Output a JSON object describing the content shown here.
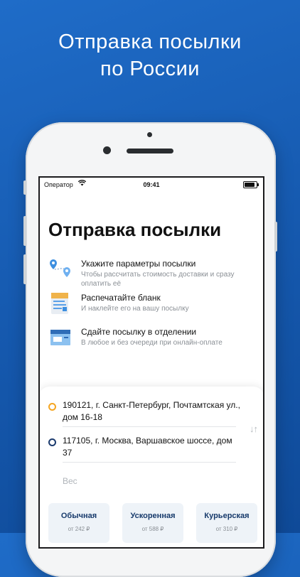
{
  "headline": {
    "line1": "Отправка посылки",
    "line2": "по России"
  },
  "status_bar": {
    "operator": "Оператор",
    "time": "09:41"
  },
  "screen": {
    "title": "Отправка посылки",
    "steps": [
      {
        "icon": "map-pins-icon",
        "title": "Укажите параметры посылки",
        "subtitle": "Чтобы рассчитать стоимость доставки и сразу оплатить её"
      },
      {
        "icon": "form-icon",
        "title": "Распечатайте бланк",
        "subtitle": "И наклейте его на вашу посылку"
      },
      {
        "icon": "parcel-icon",
        "title": "Сдайте посылку в отделении",
        "subtitle": "В любое и без очереди при онлайн-оплате"
      }
    ],
    "route": {
      "from": "190121, г. Санкт-Петербург, Почтамтская ул., дом 16-18",
      "to": "117105, г. Москва, Варшавское шоссе, дом 37",
      "swap_icon": "↓↑",
      "weight_placeholder": "Вес"
    },
    "options": [
      {
        "name": "Обычная",
        "price": "от 242 ₽"
      },
      {
        "name": "Ускоренная",
        "price": "от 588 ₽"
      },
      {
        "name": "Курьерская",
        "price": "от 310 ₽"
      }
    ]
  },
  "colors": {
    "background": "#1558ad",
    "from_marker": "#f5a623",
    "to_marker": "#1c3b6e",
    "option_bg": "#eef3f8"
  }
}
